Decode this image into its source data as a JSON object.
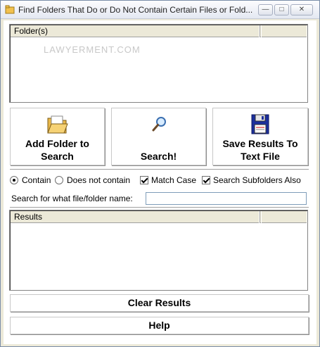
{
  "window": {
    "title": "Find Folders That Do or Do Not Contain Certain Files or Fold...",
    "minimize_glyph": "—",
    "maximize_glyph": "□",
    "close_glyph": "✕"
  },
  "folders_list": {
    "column_header": "Folder(s)",
    "watermark": "LAWYERMENT.COM",
    "rows": []
  },
  "buttons": {
    "add_folder_line1": "Add Folder to",
    "add_folder_line2": "Search",
    "search": "Search!",
    "save_line1": "Save Results To",
    "save_line2": "Text File",
    "clear_results": "Clear Results",
    "help": "Help"
  },
  "options": {
    "contain_label": "Contain",
    "contain_selected": true,
    "not_contain_label": "Does not contain",
    "match_case_label": "Match Case",
    "match_case_checked": true,
    "subfolders_label": "Search Subfolders Also",
    "subfolders_checked": true
  },
  "search": {
    "label": "Search for what file/folder name:",
    "value": ""
  },
  "results_list": {
    "column_header": "Results",
    "rows": []
  },
  "icons": {
    "app": "app-icon",
    "add_folder": "open-folder-icon",
    "search": "magnifier-icon",
    "save": "floppy-disk-icon"
  }
}
